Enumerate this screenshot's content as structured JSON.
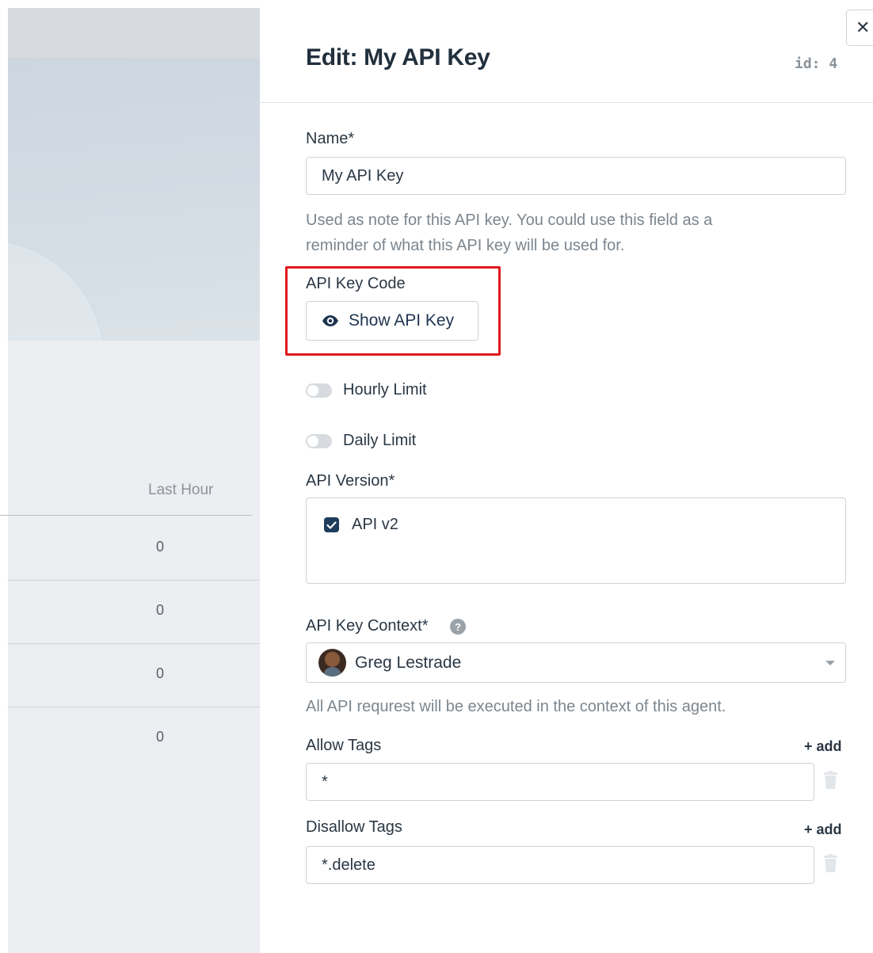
{
  "background_page": {
    "table": {
      "column_header": "Last Hour",
      "rows": [
        "0",
        "0",
        "0",
        "0"
      ]
    }
  },
  "panel": {
    "title": "Edit: My API Key",
    "id_label": "id: 4",
    "close_icon": "close-icon",
    "name_field": {
      "label": "Name*",
      "value": "My API Key",
      "help_line1": "Used as note for this API key. You could use this field as a",
      "help_line2": "reminder of what this API key will be used for."
    },
    "api_key_code": {
      "label": "API Key Code",
      "button_label": "Show API Key",
      "button_icon": "eye-icon",
      "highlight_color": "#e0191e"
    },
    "toggles": {
      "hourly_limit": {
        "label": "Hourly Limit",
        "enabled": false
      },
      "daily_limit": {
        "label": "Daily Limit",
        "enabled": false
      }
    },
    "api_version": {
      "label": "API Version*",
      "options": [
        {
          "label": "API v2",
          "checked": true
        }
      ]
    },
    "api_key_context": {
      "label": "API Key Context*",
      "help_icon": "question-icon",
      "selected_agent": "Greg Lestrade",
      "help_text": "All API requrest will be executed in the context of this agent."
    },
    "allow_tags": {
      "label": "Allow Tags",
      "add_label": "+ add",
      "values": [
        "*"
      ]
    },
    "disallow_tags": {
      "label": "Disallow Tags",
      "add_label": "+ add",
      "values": [
        "*.delete"
      ]
    }
  },
  "colors": {
    "accent_dark": "#1d3d5b",
    "checkbox": "#1d3d5b",
    "highlight": "#e0191e"
  }
}
